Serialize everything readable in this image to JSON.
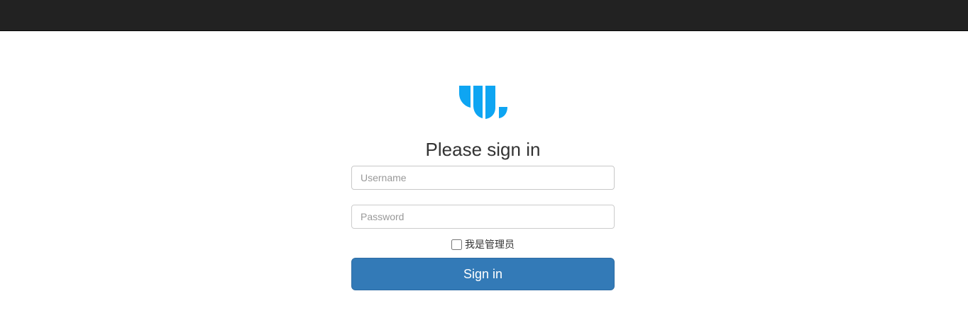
{
  "form": {
    "title": "Please sign in",
    "username_placeholder": "Username",
    "password_placeholder": "Password",
    "admin_label": "我是管理员",
    "submit_label": "Sign in"
  },
  "colors": {
    "topbar": "#222222",
    "logo": "#0ea5f2",
    "primary_button": "#337ab7"
  },
  "icons": {
    "logo": "brand-logo-icon"
  }
}
